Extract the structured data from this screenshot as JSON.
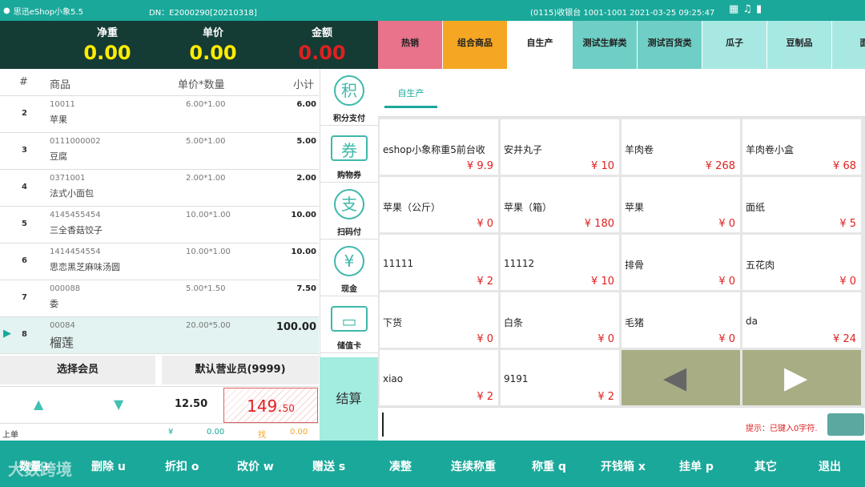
{
  "topbar": {
    "logo": "思迅eShop小象5.5",
    "dn": "DN：E2000290[20210318]",
    "register": "(0115)收银台 1001-1001   2021-03-25 09:25:47"
  },
  "totals": {
    "weight_label": "净重",
    "weight": "0.00",
    "unit_label": "单价",
    "unit": "0.00",
    "amount_label": "金额",
    "amount": "0.00"
  },
  "table": {
    "headers": [
      "#",
      "商品",
      "单价*数量",
      "小计"
    ],
    "rows": [
      {
        "idx": "2",
        "code": "10011",
        "name": "苹果",
        "pq": "6.00*1.00",
        "sub": "6.00"
      },
      {
        "idx": "3",
        "code": "0111000002",
        "name": "豆腐",
        "pq": "5.00*1.00",
        "sub": "5.00"
      },
      {
        "idx": "4",
        "code": "0371001",
        "name": "法式小面包",
        "pq": "2.00*1.00",
        "sub": "2.00"
      },
      {
        "idx": "5",
        "code": "4145455454",
        "name": "三全香菇饺子",
        "pq": "10.00*1.00",
        "sub": "10.00"
      },
      {
        "idx": "6",
        "code": "1414454554",
        "name": "思恋黑芝麻味汤圆",
        "pq": "10.00*1.00",
        "sub": "10.00"
      },
      {
        "idx": "7",
        "code": "000088",
        "name": "委",
        "pq": "5.00*1.50",
        "sub": "7.50"
      },
      {
        "idx": "8",
        "code": "00084",
        "name": "榴莲",
        "pq": "20.00*5.00",
        "sub": "100.00"
      }
    ]
  },
  "pay": [
    "积分支付",
    "购物券",
    "扫码付",
    "现金",
    "储值卡"
  ],
  "pay_icons": [
    "ji",
    "quan",
    "zhi",
    "yuan",
    "card"
  ],
  "member": {
    "select": "选择会员",
    "clerk": "默认营业员(9999)"
  },
  "ctrl": {
    "qty": "12.50",
    "price": "149.",
    "price_dec": "50"
  },
  "sumbar": {
    "label": "上单",
    "yen": "¥",
    "val1": "0.00",
    "change": "找",
    "val2": "0.00"
  },
  "settle": "结算",
  "cats": [
    {
      "n": "热销",
      "c": "#e8738a"
    },
    {
      "n": "组合商品",
      "c": "#f5a623"
    },
    {
      "n": "自生产",
      "c": "#ffffff"
    },
    {
      "n": "测试生鲜类",
      "c": "#6fcfc6"
    },
    {
      "n": "测试百货类",
      "c": "#6fcfc6"
    },
    {
      "n": "瓜子",
      "c": "#a8e8e2"
    },
    {
      "n": "豆制品",
      "c": "#a8e8e2"
    },
    {
      "n": "面",
      "c": "#a8e8e2"
    }
  ],
  "subtab": "自生产",
  "products": [
    {
      "n": "eshop小象称重5前台收",
      "p": "¥ 9.9"
    },
    {
      "n": "安井丸子",
      "p": "¥ 10"
    },
    {
      "n": "羊肉卷",
      "p": "¥ 268"
    },
    {
      "n": "羊肉卷小盒",
      "p": "¥ 68"
    },
    {
      "n": "苹果（公斤）",
      "p": "¥ 0"
    },
    {
      "n": "苹果（箱）",
      "p": "¥ 180"
    },
    {
      "n": "苹果",
      "p": "¥ 0"
    },
    {
      "n": "面纸",
      "p": "¥ 5"
    },
    {
      "n": "11111",
      "p": "¥ 2"
    },
    {
      "n": "11112",
      "p": "¥ 10"
    },
    {
      "n": "排骨",
      "p": "¥ 0"
    },
    {
      "n": "五花肉",
      "p": "¥ 0"
    },
    {
      "n": "下货",
      "p": "¥ 0"
    },
    {
      "n": "白条",
      "p": "¥ 0"
    },
    {
      "n": "毛猪",
      "p": "¥ 0"
    },
    {
      "n": "da",
      "p": "¥ 24"
    },
    {
      "n": "xiao",
      "p": "¥ 2"
    },
    {
      "n": "9191",
      "p": "¥ 2"
    }
  ],
  "hint": "提示：已键入0字符.",
  "bottom": [
    "数量+",
    "删除 u",
    "折扣 o",
    "改价 w",
    "赠送 s",
    "凑整",
    "连续称重",
    "称重 q",
    "开钱箱 x",
    "挂单 p",
    "其它",
    "退出"
  ],
  "watermark": "大数跨境"
}
